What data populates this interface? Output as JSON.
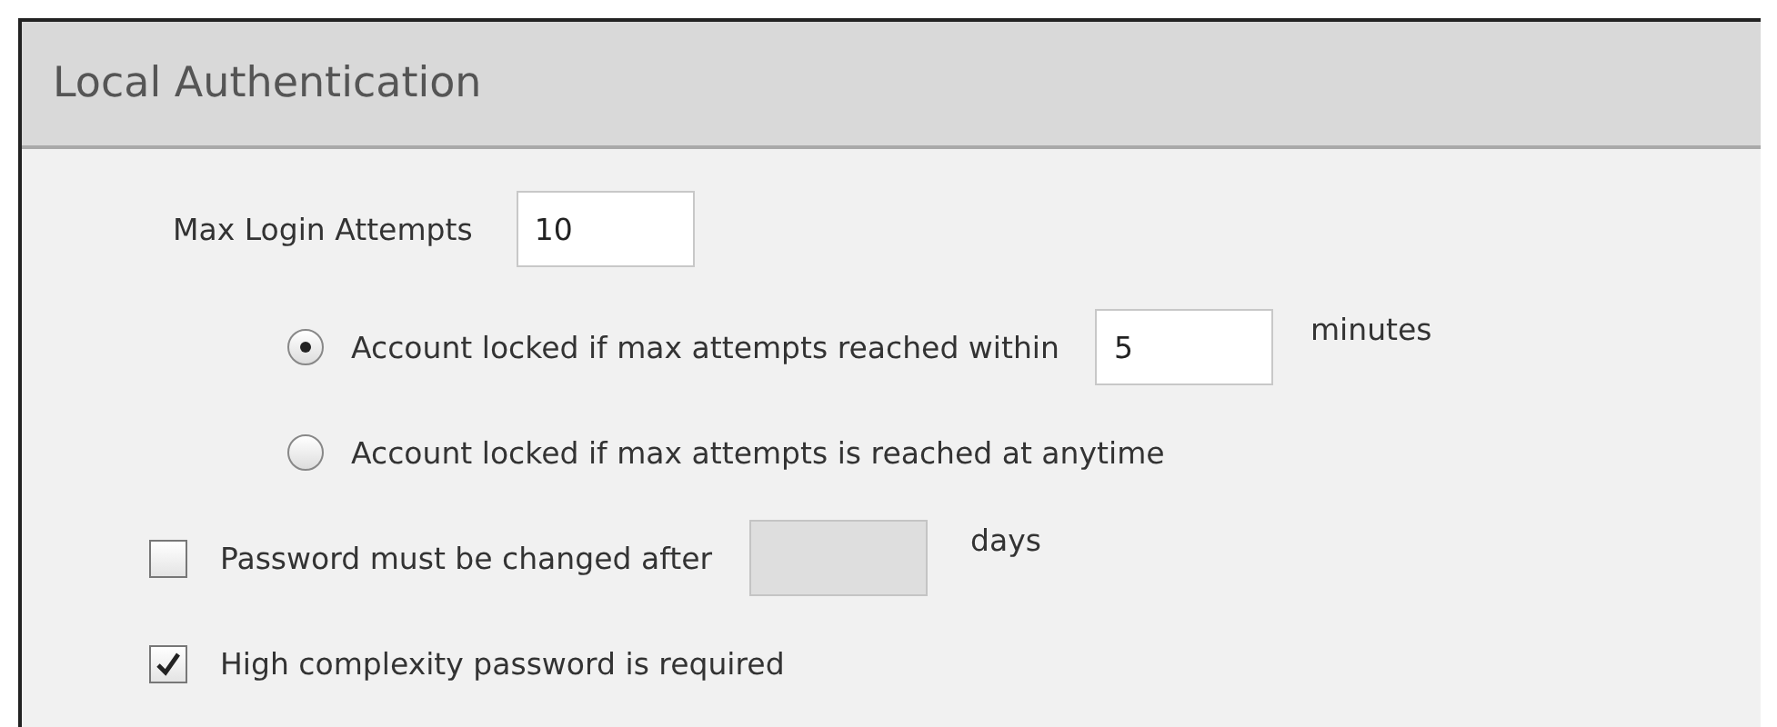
{
  "panel": {
    "title": "Local Authentication"
  },
  "max_login_attempts": {
    "label": "Max Login Attempts",
    "value": "10"
  },
  "lockout_options": [
    {
      "label": "Account locked if max attempts reached within",
      "selected": true,
      "value": "5",
      "unit": "minutes"
    },
    {
      "label": "Account locked if max attempts is reached at anytime",
      "selected": false
    }
  ],
  "password_options": [
    {
      "kind": "field",
      "label": "Password must be changed after",
      "checked": false,
      "unit": "days"
    },
    {
      "kind": "plain",
      "label": "High complexity password is required",
      "checked": true
    }
  ]
}
